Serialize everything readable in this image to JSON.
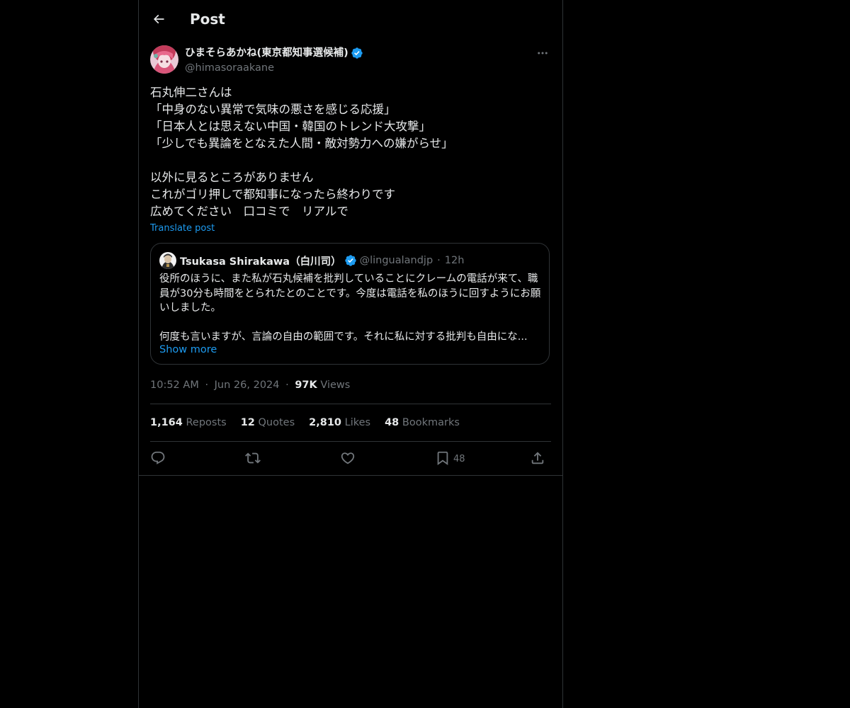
{
  "header": {
    "title": "Post"
  },
  "post": {
    "author": {
      "name": "ひまそらあかね(東京都知事選候補)",
      "handle": "@himasoraakane",
      "verified": true
    },
    "text": "石丸伸二さんは\n「中身のない異常で気味の悪さを感じる応援」\n「日本人とは思えない中国・韓国のトレンド大攻撃」\n「少しでも異論をとなえた人間・敵対勢力への嫌がらせ」\n\n以外に見るところがありません\nこれがゴリ押しで都知事になったら終わりです\n広めてください　口コミで　リアルで",
    "translate_label": "Translate post",
    "quote": {
      "name": "Tsukasa Shirakawa（白川司）",
      "handle": "@lingualandjp",
      "dot": "·",
      "time": "12h",
      "lines": [
        "役所のほうに、また私が石丸候補を批判していることにクレームの電話が来て、職員が30分も時間をとられたとのことです。今度は電話を私のほうに回すようにお願いしました。",
        "何度も言いますが、言論の自由の範囲です。それに私に対する批判も自由にな..."
      ],
      "show_more": "Show more"
    },
    "meta": {
      "time": "10:52 AM",
      "dot1": "·",
      "date": "Jun 26, 2024",
      "dot2": "·",
      "views_count": "97K",
      "views_label": "Views"
    },
    "stats": [
      {
        "count": "1,164",
        "label": "Reposts"
      },
      {
        "count": "12",
        "label": "Quotes"
      },
      {
        "count": "2,810",
        "label": "Likes"
      },
      {
        "count": "48",
        "label": "Bookmarks"
      }
    ],
    "actions": {
      "reply": "reply-icon",
      "repost": "repost-icon",
      "like": "heart-icon",
      "bookmark": "bookmark-icon",
      "bookmark_count": "48",
      "share": "share-icon"
    }
  },
  "colors": {
    "background": "#000000",
    "text": "#e7e9ea",
    "muted": "#71767b",
    "accent": "#1d9bf0",
    "border": "#2f3336"
  }
}
